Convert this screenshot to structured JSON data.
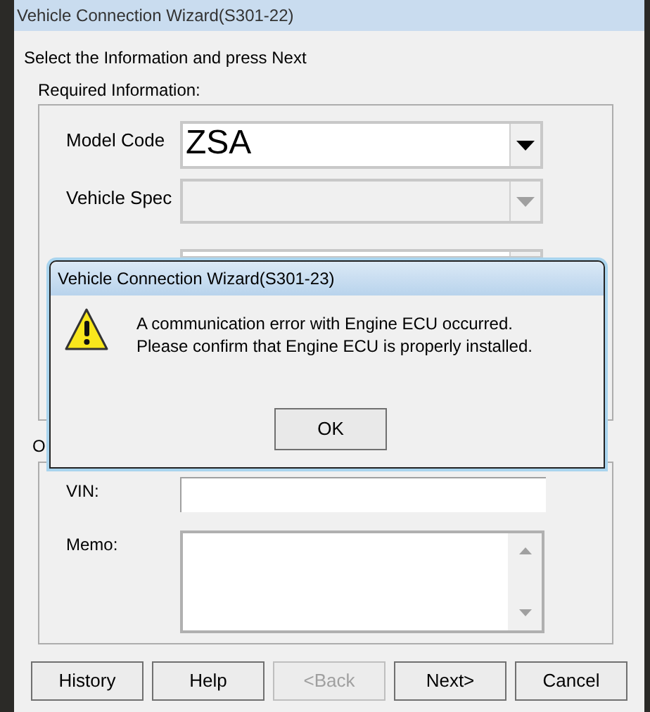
{
  "window": {
    "title": "Vehicle Connection Wizard(S301-22)"
  },
  "instruction": "Select the Information and press Next",
  "required_group": {
    "label": "Required Information:",
    "fields": [
      {
        "label": "Model Code",
        "value": "ZSA",
        "disabled": false
      },
      {
        "label": "Vehicle Spec",
        "disabled": true
      },
      {
        "disabled": false
      }
    ]
  },
  "optional_group": {
    "label": "O",
    "fields": [
      {
        "kind": "text",
        "label": "VIN:"
      },
      {
        "kind": "memo",
        "label": "Memo:"
      }
    ]
  },
  "buttons": [
    {
      "label": "History",
      "disabled": false
    },
    {
      "label": "Help",
      "disabled": false
    },
    {
      "label": "<Back",
      "disabled": true
    },
    {
      "label": "Next>",
      "disabled": false
    },
    {
      "label": "Cancel",
      "disabled": false
    }
  ],
  "dialog": {
    "title": "Vehicle Connection Wizard(S301-23)",
    "message": [
      "A communication error with Engine ECU occurred.",
      "Please confirm that Engine ECU is properly installed."
    ],
    "button": "OK"
  }
}
